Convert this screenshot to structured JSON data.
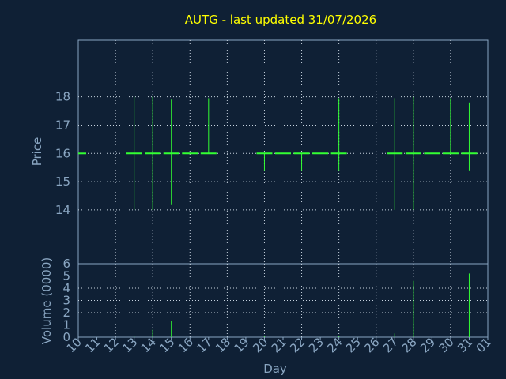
{
  "chart_data": {
    "type": "ohlc",
    "title": "AUTG - last updated 31/07/2026",
    "xlabel": "Day",
    "price_ylabel": "Price",
    "volume_ylabel": "Volume (0000)",
    "x_ticks": [
      "10",
      "11",
      "12",
      "13",
      "14",
      "15",
      "16",
      "17",
      "18",
      "19",
      "20",
      "21",
      "22",
      "23",
      "24",
      "25",
      "26",
      "27",
      "28",
      "29",
      "30",
      "31",
      "01"
    ],
    "price_yticks": [
      "14",
      "15",
      "16",
      "17",
      "18"
    ],
    "volume_yticks": [
      "0",
      "1",
      "2",
      "3",
      "4",
      "5",
      "6"
    ],
    "price_ylim": [
      12.1,
      20
    ],
    "volume_ylim": [
      0,
      6
    ],
    "x_range": [
      10,
      32
    ],
    "grid": true,
    "colors": {
      "background": "#0f2035",
      "grid": "#c8d4e0",
      "axis": "#8aa6c2",
      "bars": "#33ff33",
      "title": "#ffff00"
    },
    "price_bars": [
      {
        "day": 10,
        "high": 16.0,
        "low": 16.0,
        "close": 16.0
      },
      {
        "day": 13,
        "high": 18.0,
        "low": 14.0,
        "close": 16.0
      },
      {
        "day": 14,
        "high": 18.0,
        "low": 14.0,
        "close": 16.0
      },
      {
        "day": 15,
        "high": 17.9,
        "low": 14.2,
        "close": 16.0
      },
      {
        "day": 16,
        "high": 16.0,
        "low": 16.0,
        "close": 16.0
      },
      {
        "day": 17,
        "high": 17.95,
        "low": 16.0,
        "close": 16.0
      },
      {
        "day": 20,
        "high": 16.0,
        "low": 15.4,
        "close": 16.0
      },
      {
        "day": 21,
        "high": 16.0,
        "low": 16.0,
        "close": 16.0
      },
      {
        "day": 22,
        "high": 16.0,
        "low": 15.4,
        "close": 16.0
      },
      {
        "day": 23,
        "high": 16.0,
        "low": 16.0,
        "close": 16.0
      },
      {
        "day": 24,
        "high": 17.95,
        "low": 15.4,
        "close": 16.0
      },
      {
        "day": 27,
        "high": 17.95,
        "low": 14.0,
        "close": 16.0
      },
      {
        "day": 28,
        "high": 18.0,
        "low": 14.0,
        "close": 16.0
      },
      {
        "day": 29,
        "high": 16.0,
        "low": 16.0,
        "close": 16.0
      },
      {
        "day": 30,
        "high": 17.95,
        "low": 16.0,
        "close": 16.0
      },
      {
        "day": 31,
        "high": 17.8,
        "low": 15.4,
        "close": 16.0
      }
    ],
    "volume_bars": [
      {
        "day": 13,
        "volume": 0.1
      },
      {
        "day": 14,
        "volume": 0.6
      },
      {
        "day": 15,
        "volume": 1.3
      },
      {
        "day": 20,
        "volume": 0.05
      },
      {
        "day": 24,
        "volume": 0.05
      },
      {
        "day": 27,
        "volume": 0.3
      },
      {
        "day": 28,
        "volume": 4.6
      },
      {
        "day": 31,
        "volume": 5.2
      }
    ]
  }
}
